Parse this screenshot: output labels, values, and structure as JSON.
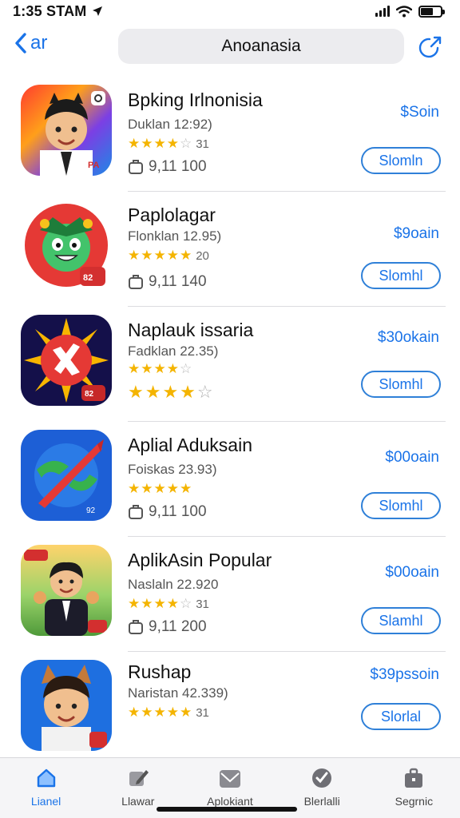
{
  "status": {
    "time": "1:35 STAM"
  },
  "nav": {
    "back_label": "ar",
    "search_text": "Anoanasia"
  },
  "apps": [
    {
      "name": "Bpking Irlnonisia",
      "sub": "Duklan 12:92)",
      "rating_text": "31",
      "meta": "9,11 100",
      "price": "$Soin",
      "button": "Slomln",
      "icon": "avatar-boy-cap-icon",
      "rating": 4
    },
    {
      "name": "Paplolagar",
      "sub": "Flonklan 12.95)",
      "rating_text": "20",
      "meta": "9,11 140",
      "price": "$9oain",
      "button": "Slomhl",
      "icon": "green-mascot-icon",
      "rating": 5
    },
    {
      "name": "Naplauk issaria",
      "sub": "Fadklan 22.35)",
      "rating_text": "",
      "meta": "",
      "price": "$30okain",
      "button": "Slomhl",
      "icon": "sun-cross-icon",
      "rating": 4
    },
    {
      "name": "Aplial Aduksain",
      "sub": "Foiskas 23.93)",
      "rating_text": "",
      "meta": "9,11 100",
      "price": "$00oain",
      "button": "Slomhl",
      "icon": "red-arrow-icon",
      "rating": 5
    },
    {
      "name": "AplikAsin Popular",
      "sub": "Naslaln 22.920",
      "rating_text": "31",
      "meta": "9,11 200",
      "price": "$00oain",
      "button": "Slamhl",
      "icon": "avatar-suit-icon",
      "rating": 4
    },
    {
      "name": "Rushap",
      "sub": "Naristan 42.339)",
      "rating_text": "31",
      "meta": "",
      "price": "$39pssoin",
      "button": "Slorlal",
      "icon": "avatar-fox-ears-icon",
      "rating": 5
    }
  ],
  "tabs": [
    {
      "label": "Lianel",
      "icon": "home-icon"
    },
    {
      "label": "Llawar",
      "icon": "pen-edit-icon"
    },
    {
      "label": "Aplokiant",
      "icon": "mail-icon"
    },
    {
      "label": "Blerlalli",
      "icon": "compass-icon"
    },
    {
      "label": "Segrnic",
      "icon": "briefcase-icon"
    }
  ],
  "colors": {
    "accent": "#1a73e8",
    "star": "#f4b400"
  }
}
